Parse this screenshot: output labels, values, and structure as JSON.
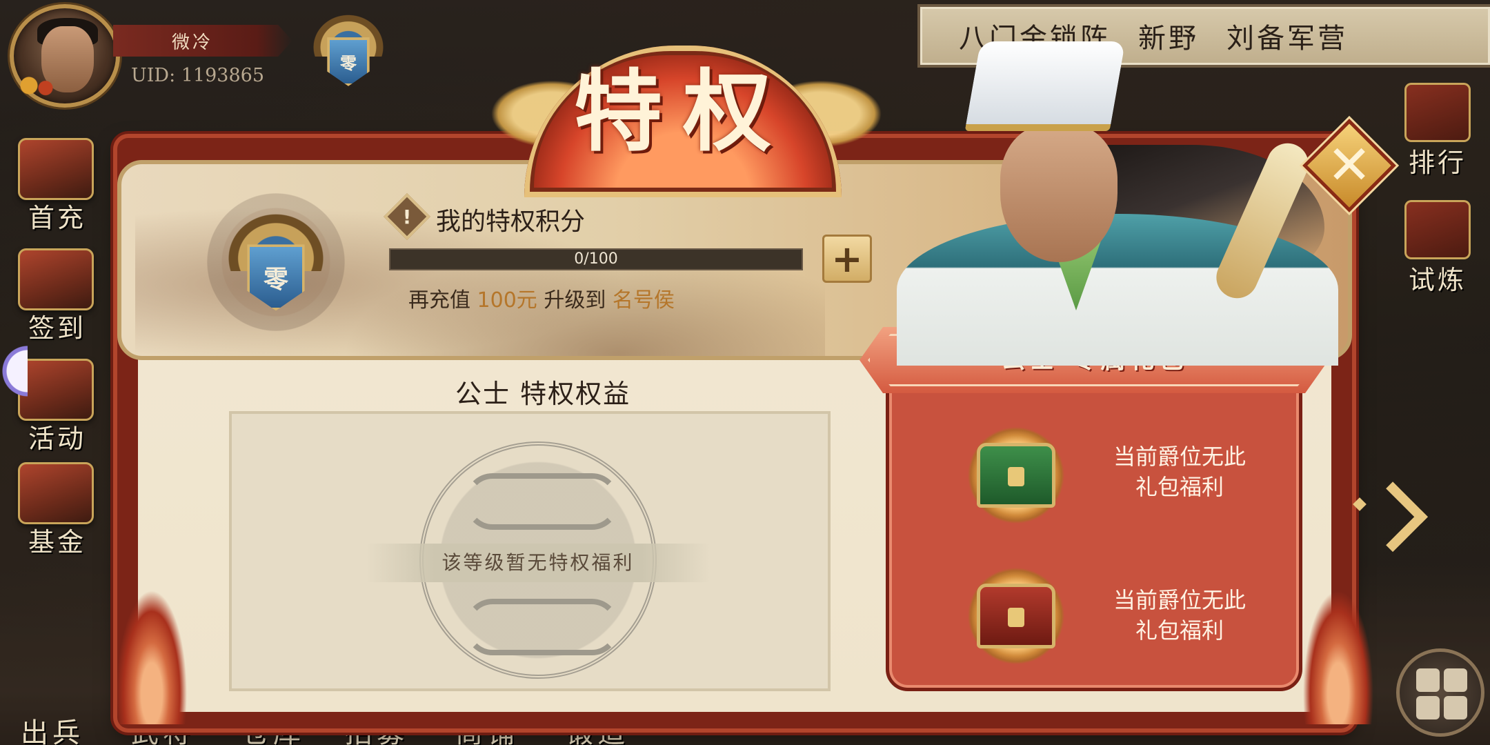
{
  "player": {
    "name": "微冷",
    "uid": "UID: 1193865",
    "rank_badge_char": "零"
  },
  "location": [
    "八门金锁阵",
    "新野",
    "刘备军营"
  ],
  "left_menu": [
    "首充",
    "签到",
    "活动",
    "基金"
  ],
  "right_menu": [
    "排行",
    "试炼"
  ],
  "bottom_menu": [
    "出兵",
    "武将",
    "仓库",
    "招募",
    "商铺",
    "锻造"
  ],
  "privilege": {
    "title": "特权",
    "badge_char": "零",
    "score_label": "我的特权积分",
    "info_icon": "!",
    "progress": {
      "current": 0,
      "max": 100,
      "text": "0/100"
    },
    "add_button": "+",
    "upgrade": {
      "prefix": "再充值",
      "amount": "100元",
      "middle": "升级到",
      "target": "名号侯"
    }
  },
  "benefits": {
    "title": "公士 特权权益",
    "empty_text": "该等级暂无特权福利"
  },
  "gift": {
    "title": "公士 专属礼包",
    "items": [
      {
        "icon": "green-chest-icon",
        "text_line1": "当前爵位无此",
        "text_line2": "礼包福利"
      },
      {
        "icon": "red-chest-icon",
        "text_line1": "当前爵位无此",
        "text_line2": "礼包福利"
      }
    ]
  },
  "close_button": "✕",
  "colors": {
    "accent_red": "#c8523e",
    "gold": "#d6b46a",
    "parchment": "#f2e8d3",
    "highlight": "#b5762a"
  }
}
